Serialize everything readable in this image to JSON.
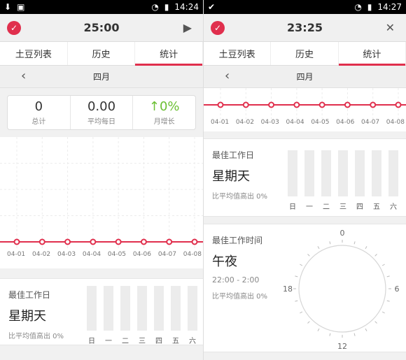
{
  "left": {
    "status": {
      "time": "14:24"
    },
    "timer": "25:00",
    "tabs": [
      "土豆列表",
      "历史",
      "统计"
    ],
    "month": "四月",
    "summary": [
      {
        "value": "0",
        "label": "总计"
      },
      {
        "value": "0.00",
        "label": "平均每日"
      },
      {
        "value": "0%",
        "label": "月增长"
      }
    ],
    "days": [
      "04-01",
      "04-02",
      "04-03",
      "04-04",
      "04-05",
      "04-06",
      "04-07",
      "04-08"
    ],
    "best_day": {
      "title": "最佳工作日",
      "value": "星期天",
      "note": "比平均值高出 0%",
      "weekdays": [
        "日",
        "一",
        "二",
        "三",
        "四",
        "五",
        "六"
      ]
    }
  },
  "right": {
    "status": {
      "time": "14:27"
    },
    "timer": "23:25",
    "tabs": [
      "土豆列表",
      "历史",
      "统计"
    ],
    "month": "四月",
    "days": [
      "04-01",
      "04-02",
      "04-03",
      "04-04",
      "04-05",
      "04-06",
      "04-07",
      "04-08"
    ],
    "best_day": {
      "title": "最佳工作日",
      "value": "星期天",
      "note": "比平均值高出 0%",
      "weekdays": [
        "日",
        "一",
        "二",
        "三",
        "四",
        "五",
        "六"
      ]
    },
    "best_time": {
      "title": "最佳工作时间",
      "value": "午夜",
      "range": "22:00 - 2:00",
      "note": "比平均值高出 0%",
      "ticks": {
        "top": "0",
        "right": "6",
        "bottom": "12",
        "left": "18"
      }
    }
  },
  "colors": {
    "accent": "#e02f4d",
    "green": "#6bbf33"
  },
  "icons": {
    "status_left": [
      "download-icon",
      "image-icon"
    ],
    "status_right": [
      "wifi-icon",
      "battery-icon"
    ],
    "play": "play-icon",
    "close": "close-icon",
    "back": "chevron-left-icon"
  },
  "chart_data": [
    {
      "type": "line",
      "x": [
        "04-01",
        "04-02",
        "04-03",
        "04-04",
        "04-05",
        "04-06",
        "04-07",
        "04-08"
      ],
      "values": [
        0,
        0,
        0,
        0,
        0,
        0,
        0,
        0
      ]
    }
  ]
}
